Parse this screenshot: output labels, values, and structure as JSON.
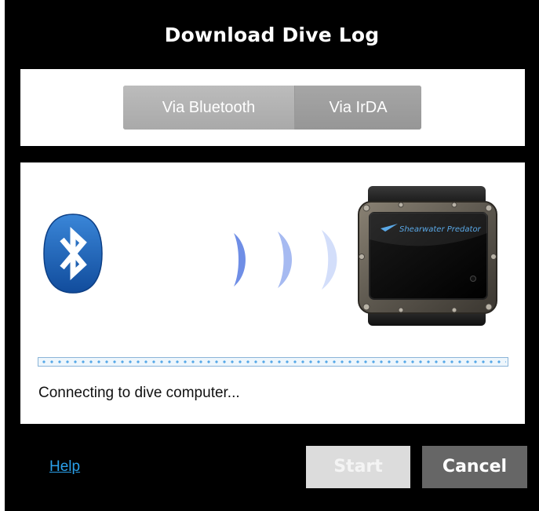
{
  "dialog": {
    "title": "Download Dive Log"
  },
  "connection_tabs": [
    {
      "label": "Via Bluetooth"
    },
    {
      "label": "Via IrDA"
    }
  ],
  "device": {
    "brand_text": "Shearwater Predator"
  },
  "progress": {
    "style": "indeterminate"
  },
  "status_text": "Connecting to dive computer...",
  "footer": {
    "help_label": "Help",
    "start_label": "Start",
    "start_enabled": false,
    "cancel_label": "Cancel"
  },
  "icons": [
    "bluetooth-icon",
    "signal-waves-icon",
    "dive-computer-image"
  ],
  "colors": {
    "background": "#000000",
    "panel": "#ffffff",
    "link": "#2aa0ea",
    "bluetooth_blue": "#1b5fb4",
    "cancel_button": "#666666",
    "start_button_disabled": "#dcdcdc"
  }
}
